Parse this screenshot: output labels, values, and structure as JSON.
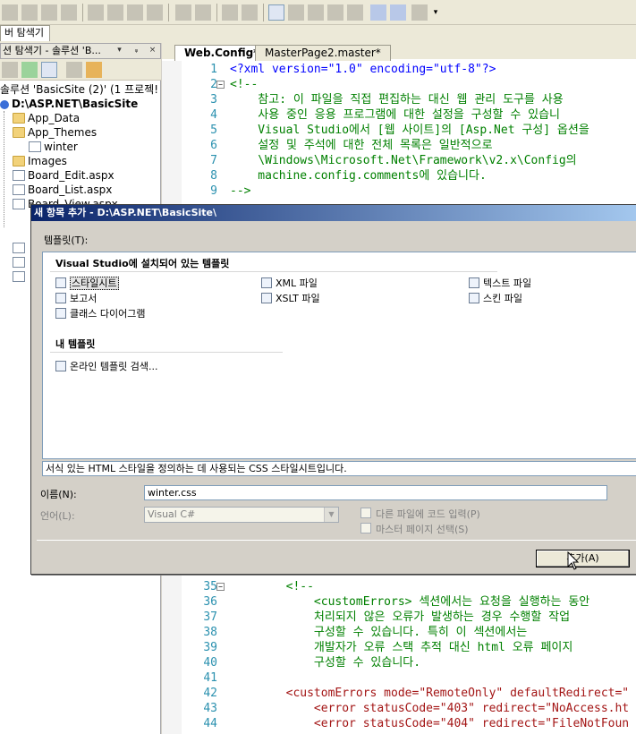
{
  "toolbar": {
    "icons": [
      "format-icon",
      "indent-icon",
      "outdent-icon",
      "comment-icon",
      "uncomment-icon",
      "bookmark-icon",
      "nav-back-icon",
      "nav-forward-icon"
    ]
  },
  "tool_window": {
    "tab_label": "버 탐색기"
  },
  "solution_explorer": {
    "title": "션 탐색기 - 솔루션 'B...",
    "pin_glyph": "▾ ⁺ ×",
    "solution_label": "솔루션 'BasicSite (2)' (1 프로젝!",
    "project_label": "D:\\ASP.NET\\BasicSite",
    "items": [
      {
        "label": "App_Data",
        "type": "folder"
      },
      {
        "label": "App_Themes",
        "type": "folder"
      },
      {
        "label": "winter",
        "type": "theme"
      },
      {
        "label": "Images",
        "type": "folder"
      },
      {
        "label": "Board_Edit.aspx",
        "type": "page"
      },
      {
        "label": "Board_List.aspx",
        "type": "page"
      },
      {
        "label": "Board_View.aspx",
        "type": "page"
      }
    ]
  },
  "editor": {
    "tabs": [
      {
        "label": "Web.Config*",
        "active": true
      },
      {
        "label": "MasterPage2.master*",
        "active": false
      }
    ],
    "top_lines": [
      {
        "n": "1",
        "text": "<?xml version=\"1.0\" encoding=\"utf-8\"?>"
      },
      {
        "n": "2",
        "text": "<!--"
      },
      {
        "n": "3",
        "text": "    참고: 이 파일을 직접 편집하는 대신 웹 관리 도구를 사용"
      },
      {
        "n": "4",
        "text": "    사용 중인 응용 프로그램에 대한 설정을 구성할 수 있습니"
      },
      {
        "n": "5",
        "text": "    Visual Studio에서 [웹 사이트]의 [Asp.Net 구성] 옵션을"
      },
      {
        "n": "6",
        "text": "    설정 및 주석에 대한 전체 목록은 일반적으로"
      },
      {
        "n": "7",
        "text": "    \\Windows\\Microsoft.Net\\Framework\\v2.x\\Config의"
      },
      {
        "n": "8",
        "text": "    machine.config.comments에 있습니다."
      },
      {
        "n": "9",
        "text": "-->"
      }
    ],
    "bottom_lines": [
      {
        "n": "35",
        "text": "        <!--"
      },
      {
        "n": "36",
        "text": "            <customErrors> 섹션에서는 요청을 실행하는 동안"
      },
      {
        "n": "37",
        "text": "            처리되지 않은 오류가 발생하는 경우 수행할 작업"
      },
      {
        "n": "38",
        "text": "            구성할 수 있습니다. 특히 이 섹션에서는"
      },
      {
        "n": "39",
        "text": "            개발자가 오류 스택 추적 대신 html 오류 페이지"
      },
      {
        "n": "40",
        "text": "            구성할 수 있습니다."
      },
      {
        "n": "41",
        "text": ""
      },
      {
        "n": "42",
        "text": "        <customErrors mode=\"RemoteOnly\" defaultRedirect=\""
      },
      {
        "n": "43",
        "text": "            <error statusCode=\"403\" redirect=\"NoAccess.ht"
      },
      {
        "n": "44",
        "text": "            <error statusCode=\"404\" redirect=\"FileNotFoun"
      }
    ]
  },
  "dialog": {
    "title": "새 항목 추가 - D:\\ASP.NET\\BasicSite\\",
    "templates_label": "템플릿(T):",
    "installed_header": "Visual Studio에 설치되어 있는 템플릿",
    "installed": [
      {
        "label": "스타일시트",
        "icon": "stylesheet-icon",
        "selected": true
      },
      {
        "label": "XML 파일",
        "icon": "xml-file-icon",
        "selected": false
      },
      {
        "label": "텍스트 파일",
        "icon": "text-file-icon",
        "selected": false
      },
      {
        "label": "보고서",
        "icon": "report-icon",
        "selected": false
      },
      {
        "label": "XSLT 파일",
        "icon": "xslt-file-icon",
        "selected": false
      },
      {
        "label": "스킨 파일",
        "icon": "skin-file-icon",
        "selected": false
      },
      {
        "label": "클래스 다이어그램",
        "icon": "class-diagram-icon",
        "selected": false
      }
    ],
    "my_header": "내 템플릿",
    "my_templates": [
      {
        "label": "온라인 템플릿 검색...",
        "icon": "search-online-icon"
      }
    ],
    "description": "서식 있는 HTML 스타일을 정의하는 데 사용되는 CSS 스타일시트입니다.",
    "name_label": "이름(N):",
    "name_value": "winter.css",
    "language_label": "언어(L):",
    "language_value": "Visual C#",
    "code_separate_label": "다른 파일에 코드 입력(P)",
    "master_page_label": "마스터 페이지 선택(S)",
    "add_button": "추가(A)"
  }
}
